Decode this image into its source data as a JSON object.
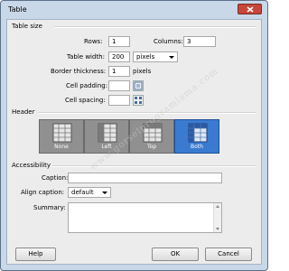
{
  "window": {
    "title": "Table",
    "close_label": "close"
  },
  "table_size": {
    "section_label": "Table size",
    "rows_label": "Rows:",
    "rows_value": "1",
    "columns_label": "Columns:",
    "columns_value": "3",
    "width_label": "Table width:",
    "width_value": "200",
    "width_unit": "pixels",
    "border_label": "Border thickness:",
    "border_value": "1",
    "border_unit": "pixels",
    "padding_label": "Cell padding:",
    "padding_value": "",
    "spacing_label": "Cell spacing:",
    "spacing_value": ""
  },
  "header": {
    "section_label": "Header",
    "options": [
      "None",
      "Left",
      "Top",
      "Both"
    ],
    "selected": "Both"
  },
  "accessibility": {
    "section_label": "Accessibility",
    "caption_label": "Caption:",
    "caption_value": "",
    "align_label": "Align caption:",
    "align_value": "default",
    "summary_label": "Summary:",
    "summary_value": ""
  },
  "footer": {
    "help": "Help",
    "ok": "OK",
    "cancel": "Cancel"
  },
  "watermark": "www.gorselprogramlama.com",
  "colors": {
    "selected_header": "#3a7bd0",
    "title_bar": "#c9d8e9",
    "close_button": "#c7473b"
  }
}
